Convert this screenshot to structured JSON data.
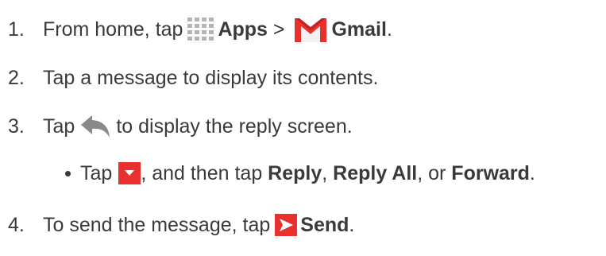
{
  "steps": [
    {
      "num": "1.",
      "t1": "From home, tap",
      "icon1": "apps-grid-icon",
      "b1": "Apps",
      "t2": " > ",
      "icon2": "gmail-icon",
      "b2": "Gmail",
      "t3": "."
    },
    {
      "num": "2.",
      "t1": "Tap a message to display its contents."
    },
    {
      "num": "3.",
      "t1": "Tap",
      "icon1": "reply-arrow-icon",
      "t2": "to display the reply screen."
    },
    {
      "num": "4.",
      "t1": "To send the message, tap",
      "icon1": "send-icon",
      "b1": "Send",
      "t2": "."
    }
  ],
  "bullet": {
    "t1": "Tap",
    "icon1": "dropdown-menu-icon",
    "t2": ", and then tap ",
    "b1": "Reply",
    "t3": ", ",
    "b2": "Reply All",
    "t4": ", or ",
    "b3": "Forward",
    "t5": "."
  },
  "colors": {
    "text": "#3a3a3a",
    "icon_red": "#e8312f",
    "icon_gray": "#b8b8b8"
  }
}
